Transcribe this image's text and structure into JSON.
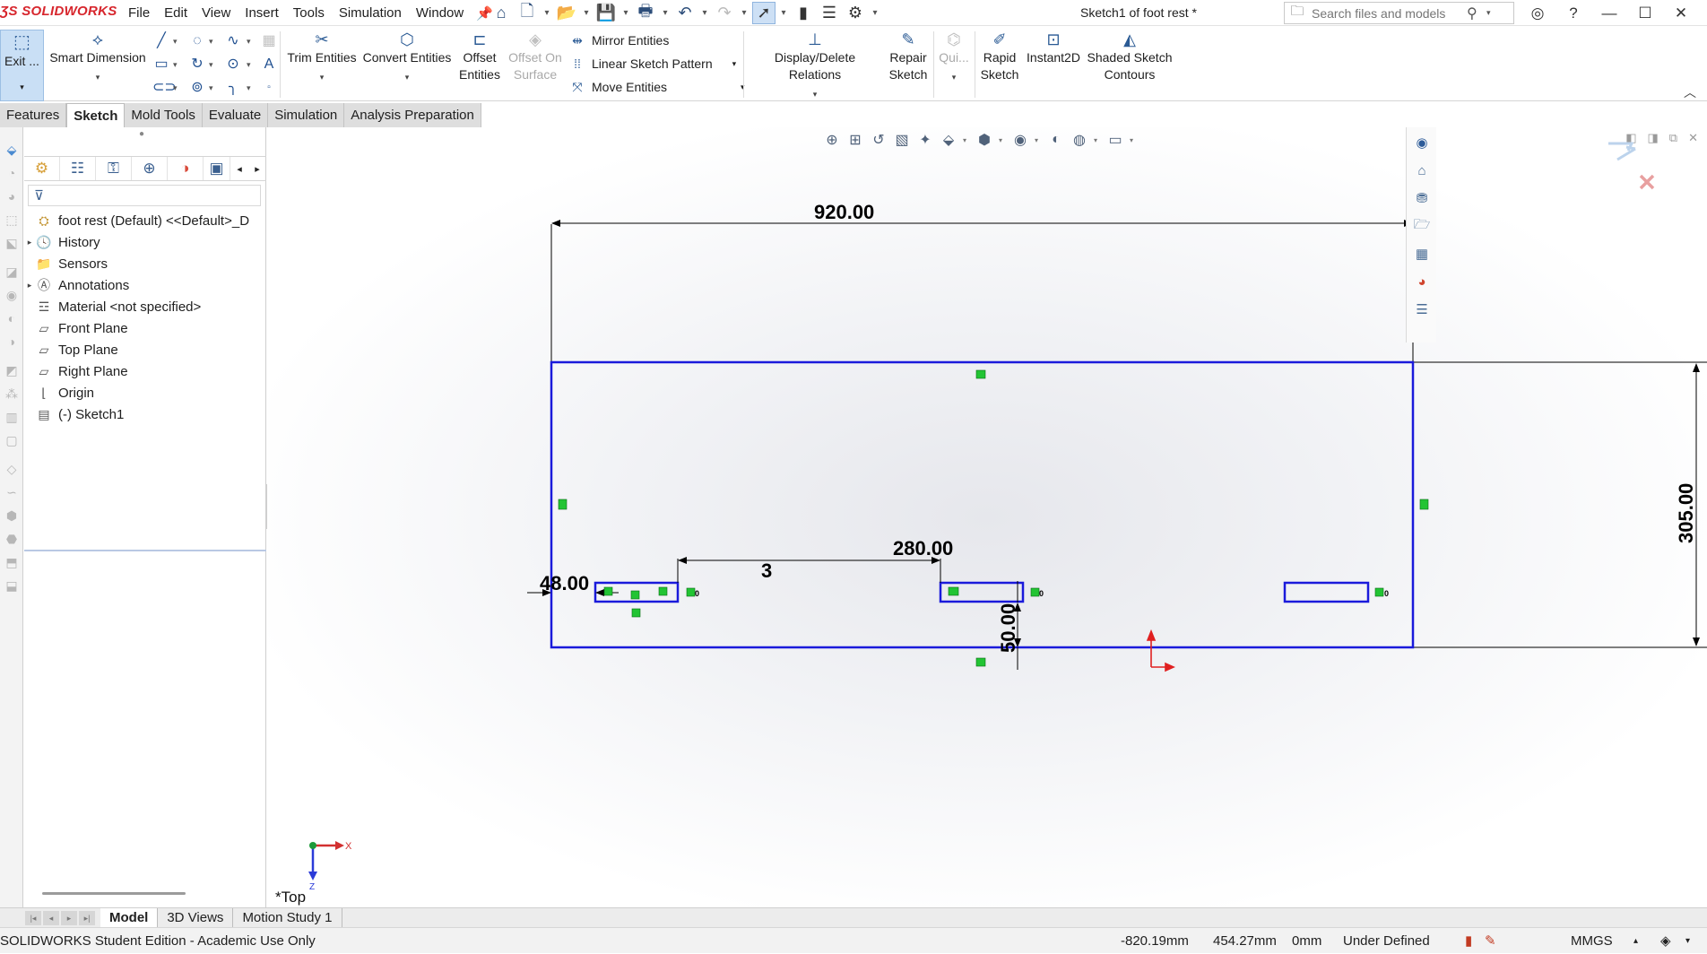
{
  "app": {
    "brand": "SOLIDWORKS",
    "document_title": "Sketch1 of foot rest *",
    "menu": [
      "File",
      "Edit",
      "View",
      "Insert",
      "Tools",
      "Simulation",
      "Window"
    ]
  },
  "search": {
    "placeholder": "Search files and models"
  },
  "command_manager": {
    "exit_sketch": "Exit ...",
    "smart_dimension": "Smart Dimension",
    "trim": "Trim Entities",
    "convert": "Convert Entities",
    "offset": "Offset Entities",
    "offset_surface": "Offset On Surface",
    "mirror": "Mirror Entities",
    "linear_pattern": "Linear Sketch Pattern",
    "move": "Move Entities",
    "display_relations": "Display/Delete Relations",
    "repair": "Repair Sketch",
    "quick_snaps": "Qui...",
    "rapid_sketch": "Rapid Sketch",
    "instant2d": "Instant2D",
    "shaded_contours": "Shaded Sketch Contours"
  },
  "tabs": [
    {
      "label": "Features",
      "active": false
    },
    {
      "label": "Sketch",
      "active": true
    },
    {
      "label": "Mold Tools",
      "active": false
    },
    {
      "label": "Evaluate",
      "active": false
    },
    {
      "label": "Simulation",
      "active": false
    },
    {
      "label": "Analysis Preparation",
      "active": false
    }
  ],
  "feature_tree": {
    "root": "foot rest (Default) <<Default>_D",
    "items": [
      {
        "label": "History",
        "icon": "history-folder-icon",
        "expandable": true
      },
      {
        "label": "Sensors",
        "icon": "sensors-folder-icon",
        "expandable": false
      },
      {
        "label": "Annotations",
        "icon": "annotations-icon",
        "expandable": true
      },
      {
        "label": "Material <not specified>",
        "icon": "material-icon",
        "expandable": false
      },
      {
        "label": "Front Plane",
        "icon": "plane-icon",
        "expandable": false
      },
      {
        "label": "Top Plane",
        "icon": "plane-icon",
        "expandable": false
      },
      {
        "label": "Right Plane",
        "icon": "plane-icon",
        "expandable": false
      },
      {
        "label": "Origin",
        "icon": "origin-icon",
        "expandable": false
      },
      {
        "label": "(-) Sketch1",
        "icon": "sketch-icon",
        "expandable": false
      }
    ]
  },
  "sketch": {
    "dimensions": {
      "overall_width": "920.00",
      "overall_height": "305.00",
      "slot_spacing": "280.00",
      "slot_pattern_count": "3",
      "edge_offset": "48.00",
      "bottom_offset": "50.00"
    },
    "view_name": "*Top",
    "triad_x_label": "X",
    "triad_z_label": "Z",
    "colors": {
      "sketch_geometry": "#1a1adb",
      "relation_glyph": "#22c433",
      "origin": "#e02020",
      "dimension": "#000000"
    }
  },
  "bottom_tabs": [
    {
      "label": "Model",
      "active": true
    },
    {
      "label": "3D Views",
      "active": false
    },
    {
      "label": "Motion Study 1",
      "active": false
    }
  ],
  "status": {
    "edition": "SOLIDWORKS Student Edition - Academic Use Only",
    "x": "-820.19mm",
    "y": "454.27mm",
    "z": "0mm",
    "state": "Under Defined",
    "units": "MMGS"
  }
}
